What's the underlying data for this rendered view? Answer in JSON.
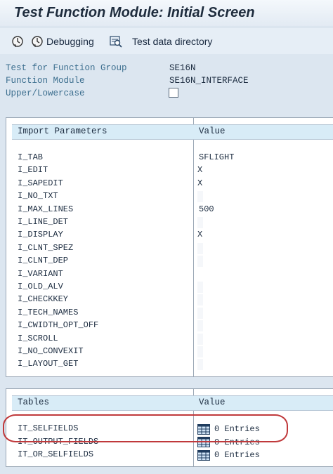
{
  "title": "Test Function Module: Initial Screen",
  "toolbar": {
    "execute_icon": "execute-clock-icon",
    "debugging_label": "Debugging",
    "test_data_label": "Test data directory"
  },
  "header": {
    "function_group_label": "Test for Function Group",
    "function_group_value": "SE16N",
    "function_module_label": "Function Module",
    "function_module_value": "SE16N_INTERFACE",
    "upper_lower_label": "Upper/Lowercase",
    "upper_lower_checked": false
  },
  "import": {
    "col_name": "Import Parameters",
    "col_value": "Value",
    "rows": [
      {
        "name": "I_TAB",
        "value": "SFLIGHT"
      },
      {
        "name": "I_EDIT",
        "value": "X"
      },
      {
        "name": "I_SAPEDIT",
        "value": "X"
      },
      {
        "name": "I_NO_TXT",
        "value": ""
      },
      {
        "name": "I_MAX_LINES",
        "value": "500"
      },
      {
        "name": "I_LINE_DET",
        "value": ""
      },
      {
        "name": "I_DISPLAY",
        "value": "X"
      },
      {
        "name": "I_CLNT_SPEZ",
        "value": ""
      },
      {
        "name": "I_CLNT_DEP",
        "value": ""
      },
      {
        "name": "I_VARIANT",
        "value": ""
      },
      {
        "name": "I_OLD_ALV",
        "value": ""
      },
      {
        "name": "I_CHECKKEY",
        "value": ""
      },
      {
        "name": "I_TECH_NAMES",
        "value": ""
      },
      {
        "name": "I_CWIDTH_OPT_OFF",
        "value": ""
      },
      {
        "name": "I_SCROLL",
        "value": ""
      },
      {
        "name": "I_NO_CONVEXIT",
        "value": ""
      },
      {
        "name": "I_LAYOUT_GET",
        "value": ""
      }
    ]
  },
  "tables": {
    "col_name": "Tables",
    "col_value": "Value",
    "rows": [
      {
        "name": "IT_SELFIELDS",
        "value": "0 Entries"
      },
      {
        "name": "IT_OUTPUT_FIELDS",
        "value": "0 Entries"
      },
      {
        "name": "IT_OR_SELFIELDS",
        "value": "0 Entries"
      }
    ]
  },
  "colors": {
    "highlight": "#c0393b",
    "label_blue": "#3d6f8f",
    "header_bg": "#d8ecf7"
  }
}
